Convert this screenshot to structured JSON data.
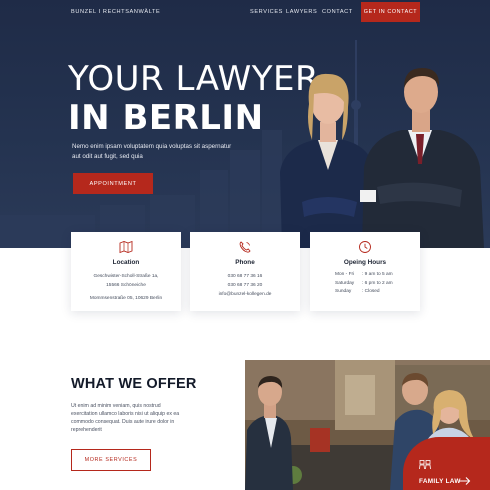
{
  "nav": {
    "brand": "BUNZEL I RECHTSANWÄLTE",
    "links": [
      "SERVICES",
      "LAWYERS",
      "CONTACT"
    ],
    "cta": "GET IN CONTACT"
  },
  "hero": {
    "title_line1": "YOUR LAWYER",
    "title_line2": "IN BERLIN",
    "subtitle": "Nemo enim ipsam voluptatem quia voluptas sit aspernatur aut odit aut fugit, sed quia",
    "button": "APPOINTMENT"
  },
  "cards": {
    "location": {
      "icon": "map-icon",
      "title": "Location",
      "lines": [
        "Geschwister-Scholl-Straße 1a,",
        "15566 Schöneiche",
        "",
        "Mommsenstraße 05, 10629 Berlin"
      ]
    },
    "phone": {
      "icon": "phone-icon",
      "title": "Phone",
      "lines": [
        "030 68 77 36 16",
        "030 68 77 36 20",
        "info@bunzel-kollegen.de"
      ]
    },
    "hours": {
      "icon": "clock-icon",
      "title": "Opeing Hours",
      "rows": [
        {
          "day": "Mon - Fri",
          "time": ": 9 am to 5 am"
        },
        {
          "day": "Saturday",
          "time": ": 6 pm to 2 am"
        },
        {
          "day": "Sunday",
          "time": ": Closed"
        }
      ]
    }
  },
  "offer": {
    "title": "WHAT WE OFFER",
    "text": "Ut enim ad minim veniam, quis nostrud exercitation ullamco laboris nisi ut aliquip ex ea commodo consequat. Duis aute irure dolor in reprehenderit",
    "button": "MORE SERVICES"
  },
  "feature": {
    "icon": "family-icon",
    "label": "FAMILY LAW",
    "arrow_icon": "arrow-right-icon"
  },
  "colors": {
    "accent": "#b5281c",
    "navy": "#1f2b47",
    "heading": "#131a29"
  }
}
